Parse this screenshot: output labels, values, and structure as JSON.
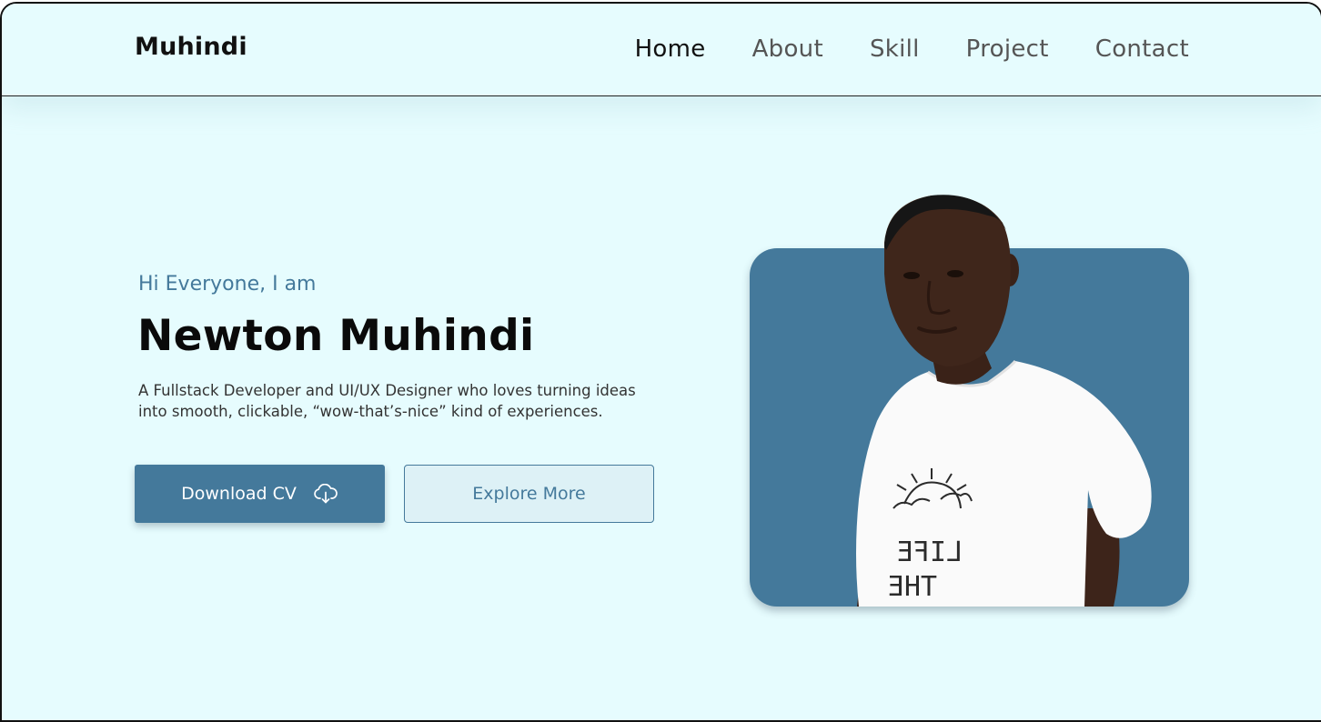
{
  "nav": {
    "logo": "Muhindi",
    "links": [
      "Home",
      "About",
      "Skill",
      "Project",
      "Contact"
    ]
  },
  "hero": {
    "greeting": "Hi Everyone, I am",
    "name": "Newton Muhindi",
    "bio_line1": "A Fullstack Developer and UI/UX Designer who loves turning ideas",
    "bio_line2": "into smooth, clickable, “wow-that’s-nice” kind of experiences.",
    "primary_button": "Download CV",
    "secondary_button": "Explore More",
    "primary_icon": "cloud-download-icon"
  },
  "colors": {
    "background": "#e6fcfe",
    "accent": "#44799b",
    "secondary_button_bg": "#ddf1f6"
  }
}
